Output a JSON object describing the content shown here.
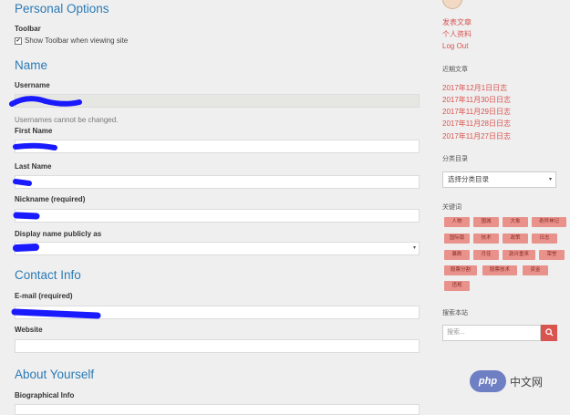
{
  "sections": {
    "personal": "Personal Options",
    "name": "Name",
    "contact": "Contact Info",
    "about": "About Yourself"
  },
  "toolbar": {
    "label": "Toolbar",
    "checkbox_label": "Show Toolbar when viewing site",
    "checked": true
  },
  "fields": {
    "username": "Username",
    "username_note": "Usernames cannot be changed.",
    "first_name": "First Name",
    "last_name": "Last Name",
    "nickname": "Nickname (required)",
    "display_name": "Display name publicly as",
    "email": "E-mail (required)",
    "website": "Website",
    "bio": "Biographical Info"
  },
  "sidebar": {
    "links": [
      "发表文章",
      "个人资料",
      "Log Out"
    ],
    "recent_heading": "近期文章",
    "recent_posts": [
      "2017年12月1日日志",
      "2017年11月30日日志",
      "2017年11月29日日志",
      "2017年11月28日日志",
      "2017年11月27日日志"
    ],
    "category_heading": "分类目录",
    "category_select": "选择分类目录",
    "tags_heading": "关键词",
    "tags": [
      "人物",
      "围城",
      "大象",
      "奇异神记",
      "国际版",
      "技术",
      "政策",
      "日志",
      "暴跌",
      "月佳",
      "敦许重来",
      "荣誉",
      "股票分割",
      "股票技术",
      "资金",
      "违规"
    ],
    "search_heading": "搜索本站",
    "search_placeholder": "搜索..."
  },
  "watermark": {
    "logo": "php",
    "text": "中文网"
  },
  "colors": {
    "accent_blue": "#2b7ab5",
    "link_red": "#d9534f",
    "tag_bg": "#e9928c",
    "redaction": "#1a1aff"
  }
}
